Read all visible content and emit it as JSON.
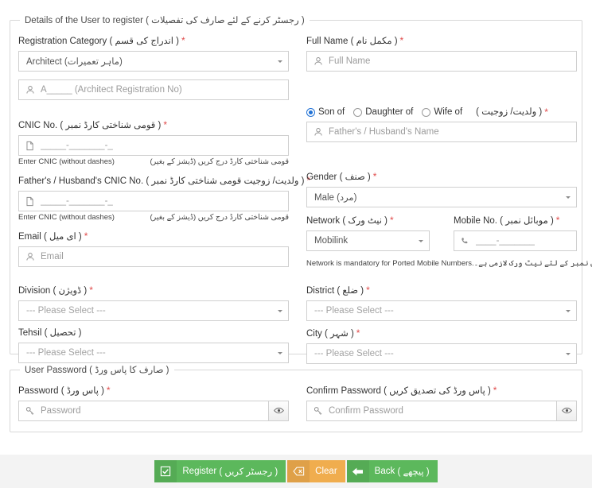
{
  "details": {
    "legend_en": "Details of the User to register",
    "legend_ur": "( رجسٹر کرنے کے لئے صارف کی تفصیلات )",
    "registration_category": {
      "label_en": "Registration Category",
      "label_ur": "( اندراج کی قسم )",
      "value": "Architect (ماہر تعمیرات)"
    },
    "registration_no": {
      "placeholder": "A_____  (Architect Registration No)"
    },
    "cnic": {
      "label_en": "CNIC No.",
      "label_ur": "( قومی شناختی کارڈ نمبر )",
      "placeholder": "_____-_______-_",
      "help_en": "Enter CNIC (without dashes)",
      "help_ur": "قومی شناختی کارڈ درج کریں (ڈیشز کے بغیر)"
    },
    "father_cnic": {
      "label_en": "Father's / Husband's CNIC No.",
      "label_ur": "( ولدیت/ زوجیت قومی شناختی کارڈ نمبر )",
      "placeholder": "_____-_______-_",
      "help_en": "Enter CNIC (without dashes)",
      "help_ur": "قومی شناختی کارڈ درج کریں (ڈیشز کے بغیر)"
    },
    "email": {
      "label_en": "Email",
      "label_ur": "( ای میل )",
      "placeholder": "Email"
    },
    "division": {
      "label_en": "Division",
      "label_ur": "( ڈویژن )",
      "value": "--- Please Select ---"
    },
    "tehsil": {
      "label_en": "Tehsil",
      "label_ur": "( تحصیل )",
      "value": "--- Please Select ---"
    },
    "full_name": {
      "label_en": "Full Name",
      "label_ur": "( مکمل نام )",
      "placeholder": "Full Name"
    },
    "relation": {
      "label_ur": "( ولدیت/ زوجیت )",
      "options": [
        "Son of",
        "Daughter of",
        "Wife of"
      ],
      "selected": "Son of",
      "placeholder": "Father's / Husband's Name"
    },
    "gender": {
      "label_en": "Gender",
      "label_ur": "( صنف )",
      "value": "Male (مرد)"
    },
    "network": {
      "label_en": "Network",
      "label_ur": "( نیٹ ورک )",
      "value": "Mobilink"
    },
    "mobile": {
      "label_en": "Mobile No.",
      "label_ur": "( موبائل نمبر )",
      "placeholder": "____-_______"
    },
    "network_help_en": "Network is mandatory for Ported Mobile Numbers.",
    "network_help_ur": "پورٹڈ موبائل نمبر کے لئے نیٹ ورک لازمی ہے۔",
    "district": {
      "label_en": "District",
      "label_ur": "( ضلع )",
      "value": "--- Please Select ---"
    },
    "city": {
      "label_en": "City",
      "label_ur": "( شہر )",
      "value": "--- Please Select ---"
    }
  },
  "password_section": {
    "legend_en": "User Password",
    "legend_ur": "( صارف کا پاس ورڈ )",
    "password": {
      "label_en": "Password",
      "label_ur": "( پاس ورڈ )",
      "placeholder": "Password"
    },
    "confirm_password": {
      "label_en": "Confirm Password",
      "label_ur": "( پاس ورڈ کی تصدیق کریں )",
      "placeholder": "Confirm Password"
    }
  },
  "footer": {
    "register": {
      "label_en": "Register",
      "label_ur": "( رجسٹر کریں )"
    },
    "clear": {
      "label_en": "Clear"
    },
    "back": {
      "label_en": "Back",
      "label_ur": "( پیچھے )"
    }
  },
  "colors": {
    "required": "#e04b4b",
    "primary_green": "#5cb85c",
    "warning_orange": "#f0ad4e",
    "radio_selected": "#2172d6",
    "footer_bg": "#f3f3f3",
    "border": "#cfcfcf"
  }
}
